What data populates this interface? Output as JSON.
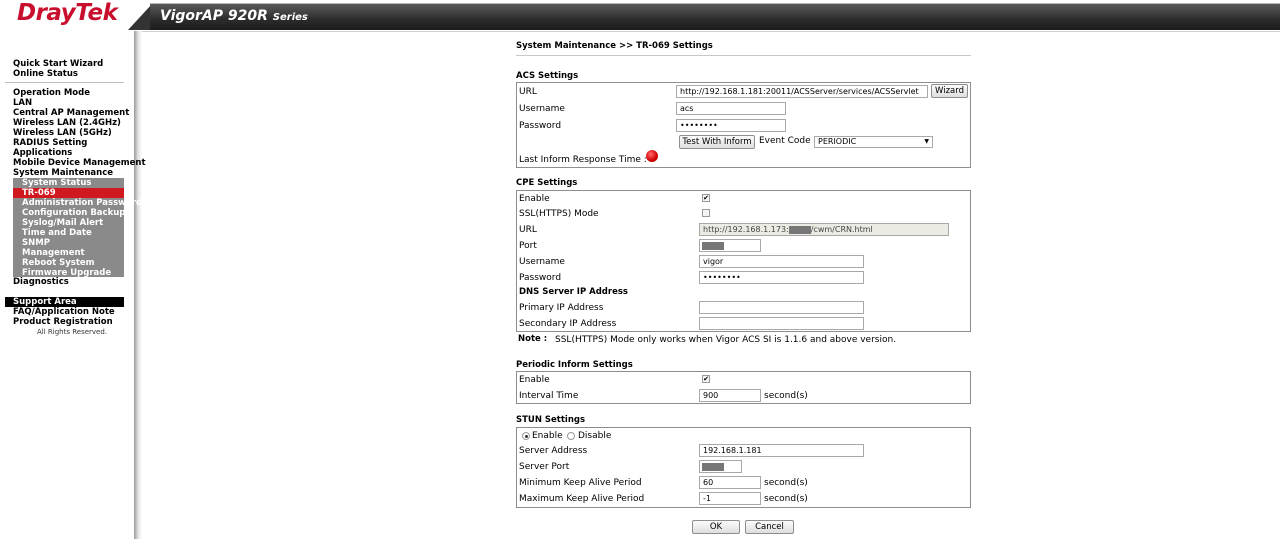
{
  "header": {
    "logo": "DrayTek",
    "product": "VigorAP 920R",
    "series": "Series"
  },
  "sidebar": {
    "top_items": [
      "Quick Start Wizard",
      "Online Status"
    ],
    "main_items": [
      "Operation Mode",
      "LAN",
      "Central AP Management",
      "Wireless LAN (2.4GHz)",
      "Wireless LAN (5GHz)",
      "RADIUS Setting",
      "Applications",
      "Mobile Device Management",
      "System Maintenance"
    ],
    "sub_items": [
      "System Status",
      "TR-069",
      "Administration Password",
      "Configuration Backup",
      "Syslog/Mail Alert",
      "Time and Date",
      "SNMP",
      "Management",
      "Reboot System",
      "Firmware Upgrade"
    ],
    "diagnostics": "Diagnostics",
    "support_header": "Support Area",
    "support_items": [
      "FAQ/Application Note",
      "Product Registration"
    ],
    "rights": "All Rights Reserved."
  },
  "breadcrumb": "System Maintenance >> TR-069 Settings",
  "acs": {
    "title": "ACS Settings",
    "url_label": "URL",
    "url_value": "http://192.168.1.181:20011/ACSServer/services/ACSServlet",
    "wizard_button": "Wizard",
    "username_label": "Username",
    "username_value": "acs",
    "password_label": "Password",
    "password_value": "••••••••",
    "test_button": "Test With Inform",
    "event_code_label": "Event Code",
    "event_code_value": "PERIODIC",
    "last_inform_label": "Last Inform Response Time :"
  },
  "cpe": {
    "title": "CPE Settings",
    "enable_label": "Enable",
    "enable_checked": true,
    "ssl_label": "SSL(HTTPS) Mode",
    "ssl_checked": false,
    "url_label": "URL",
    "url_prefix": "http://192.168.1.173:",
    "url_suffix": "/cwm/CRN.html",
    "port_label": "Port",
    "username_label": "Username",
    "username_value": "vigor",
    "password_label": "Password",
    "password_value": "••••••••",
    "dns_title": "DNS Server IP Address",
    "primary_label": "Primary IP Address",
    "primary_value": "",
    "secondary_label": "Secondary IP Address",
    "secondary_value": ""
  },
  "note": {
    "label": "Note :",
    "text": "SSL(HTTPS) Mode only works when Vigor ACS SI is 1.1.6 and above version."
  },
  "periodic": {
    "title": "Periodic Inform Settings",
    "enable_label": "Enable",
    "enable_checked": true,
    "interval_label": "Interval Time",
    "interval_value": "900",
    "interval_unit": "second(s)"
  },
  "stun": {
    "title": "STUN Settings",
    "enable_label": "Enable",
    "disable_label": "Disable",
    "selected": "Enable",
    "server_address_label": "Server Address",
    "server_address_value": "192.168.1.181",
    "server_port_label": "Server Port",
    "min_label": "Minimum Keep Alive Period",
    "min_value": "60",
    "min_unit": "second(s)",
    "max_label": "Maximum Keep Alive Period",
    "max_value": "-1",
    "max_unit": "second(s)"
  },
  "buttons": {
    "ok": "OK",
    "cancel": "Cancel"
  },
  "colors": {
    "brand_red": "#c8102e",
    "active_nav": "#d0181f",
    "submenu_bg": "#8a8a8a"
  }
}
